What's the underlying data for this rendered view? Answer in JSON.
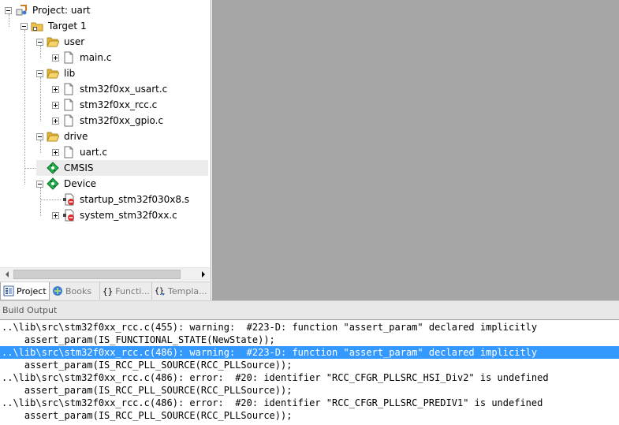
{
  "project_tree": {
    "project": "Project: uart",
    "target": "Target 1",
    "groups": [
      {
        "name": "user",
        "files": [
          "main.c"
        ]
      },
      {
        "name": "lib",
        "files": [
          "stm32f0xx_usart.c",
          "stm32f0xx_rcc.c",
          "stm32f0xx_gpio.c"
        ]
      },
      {
        "name": "drive",
        "files": [
          "uart.c"
        ]
      }
    ],
    "components": {
      "cmsis": "CMSIS",
      "device": "Device",
      "device_files": [
        "startup_stm32f030x8.s",
        "system_stm32f0xx.c"
      ]
    }
  },
  "panel_tabs": [
    {
      "label": "Project",
      "icon": "project-icon",
      "active": true
    },
    {
      "label": "Books",
      "icon": "books-icon",
      "active": false
    },
    {
      "label": "Functi...",
      "icon": "functions-icon",
      "active": false
    },
    {
      "label": "Templa...",
      "icon": "templates-icon",
      "active": false
    }
  ],
  "build_output": {
    "title": "Build Output",
    "lines": [
      {
        "text": "..\\lib\\src\\stm32f0xx_rcc.c(455): warning:  #223-D: function \"assert_param\" declared implicitly",
        "highlighted": false
      },
      {
        "text": "    assert_param(IS_FUNCTIONAL_STATE(NewState));",
        "highlighted": false
      },
      {
        "text": "..\\lib\\src\\stm32f0xx_rcc.c(486): warning:  #223-D: function \"assert_param\" declared implicitly",
        "highlighted": true
      },
      {
        "text": "    assert_param(IS_RCC_PLL_SOURCE(RCC_PLLSource));",
        "highlighted": false
      },
      {
        "text": "..\\lib\\src\\stm32f0xx_rcc.c(486): error:  #20: identifier \"RCC_CFGR_PLLSRC_HSI_Div2\" is undefined",
        "highlighted": false
      },
      {
        "text": "    assert_param(IS_RCC_PLL_SOURCE(RCC_PLLSource));",
        "highlighted": false
      },
      {
        "text": "..\\lib\\src\\stm32f0xx_rcc.c(486): error:  #20: identifier \"RCC_CFGR_PLLSRC_PREDIV1\" is undefined",
        "highlighted": false
      },
      {
        "text": "    assert_param(IS_RCC_PLL_SOURCE(RCC_PLLSource));",
        "highlighted": false
      }
    ]
  },
  "colors": {
    "editor_background": "#a6a6a6",
    "selection_highlight": "#3399ff",
    "folder": "#f0c44c",
    "component_diamond": "#22b14c"
  }
}
